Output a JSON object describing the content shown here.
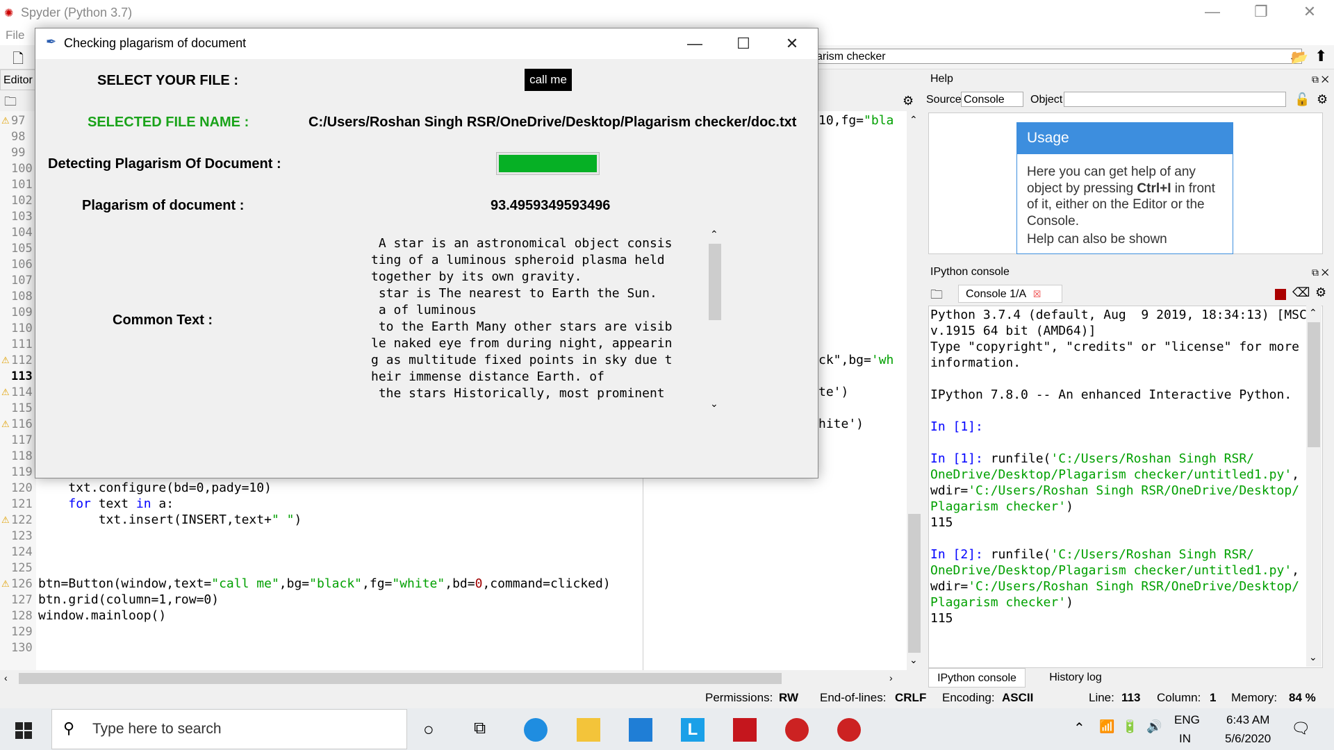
{
  "spyder": {
    "window_title": "Spyder (Python 3.7)",
    "menu_file": "File",
    "working_dir_fragment": "arism checker",
    "editor_label": "Editor",
    "editor_lines": [
      {
        "n": "97",
        "warn": true
      },
      {
        "n": "98"
      },
      {
        "n": "99"
      },
      {
        "n": "100"
      },
      {
        "n": "101"
      },
      {
        "n": "102"
      },
      {
        "n": "103"
      },
      {
        "n": "104"
      },
      {
        "n": "105"
      },
      {
        "n": "106"
      },
      {
        "n": "107"
      },
      {
        "n": "108"
      },
      {
        "n": "109"
      },
      {
        "n": "110"
      },
      {
        "n": "111"
      },
      {
        "n": "112",
        "warn": true
      },
      {
        "n": "113",
        "current": true
      },
      {
        "n": "114",
        "warn": true
      },
      {
        "n": "115"
      },
      {
        "n": "116",
        "warn": true
      },
      {
        "n": "117"
      },
      {
        "n": "118"
      },
      {
        "n": "119"
      },
      {
        "n": "120"
      },
      {
        "n": "121"
      },
      {
        "n": "122",
        "warn": true
      },
      {
        "n": "123"
      },
      {
        "n": "124"
      },
      {
        "n": "125"
      },
      {
        "n": "126",
        "warn": true
      },
      {
        "n": "127"
      },
      {
        "n": "128"
      },
      {
        "n": "129"
      },
      {
        "n": "130"
      }
    ],
    "code": {
      "line120": "    txt.configure(bd=0,pady=10)",
      "line121_kw1": "for",
      "line121_mid": " text ",
      "line121_kw2": "in",
      "line121_end": " a:",
      "line122_a": "        txt.insert(INSERT,text+",
      "line122_str": "\" \"",
      "line122_b": ")",
      "line126_a": "btn=Button(window,text=",
      "line126_s1": "\"call me\"",
      "line126_b": ",bg=",
      "line126_s2": "\"black\"",
      "line126_c": ",fg=",
      "line126_s3": "\"white\"",
      "line126_d": ",bd=",
      "line126_n": "0",
      "line126_e": ",command=clicked)",
      "line127": "btn.grid(column=1,row=0)",
      "line128": "window.mainloop()"
    },
    "editor2": {
      "l97_a": "10,fg=",
      "l97_s": "\"bla",
      "l112_a": "ck\",bg=",
      "l112_s": "'wh",
      "l114": "te')",
      "l116": "hite')"
    },
    "help": {
      "title": "Help",
      "source_label": "Source",
      "source_value": "Console",
      "object_label": "Object",
      "usage_title": "Usage",
      "usage_text_1": "Here you can get help of any object by pressing ",
      "usage_bold": "Ctrl+I",
      "usage_text_2": " in front of it, either on the Editor or the Console.",
      "usage_text_3": "Help can also be shown"
    },
    "ipython": {
      "title": "IPython console",
      "tab_label": "Console 1/A",
      "lines": {
        "l1": "Python 3.7.4 (default, Aug  9 2019, 18:34:13) [MSC",
        "l2": "v.1915 64 bit (AMD64)]",
        "l3": "Type \"copyright\", \"credits\" or \"license\" for more",
        "l4": "information.",
        "l5": "IPython 7.8.0 -- An enhanced Interactive Python.",
        "p1": "In [1]:",
        "p2": "In [1]:",
        "r1a": " runfile(",
        "r1b": "'C:/Users/Roshan Singh RSR/",
        "r1c": "OneDrive/Desktop/Plagarism checker/untitled1.py'",
        "r1d": ",",
        "r1e": "wdir=",
        "r1f": "'C:/Users/Roshan Singh RSR/OneDrive/Desktop/",
        "r1g": "Plagarism checker'",
        "r1h": ")",
        "out1": "115",
        "p3": "In [2]:",
        "out2": "115"
      },
      "bottom_tab_1": "IPython console",
      "bottom_tab_2": "History log"
    },
    "status": {
      "permissions_label": "Permissions:",
      "permissions_value": "RW",
      "eol_label": "End-of-lines:",
      "eol_value": "CRLF",
      "encoding_label": "Encoding:",
      "encoding_value": "ASCII",
      "line_label": "Line:",
      "line_value": "113",
      "column_label": "Column:",
      "column_value": "1",
      "memory_label": "Memory:",
      "memory_value": "84 %"
    }
  },
  "dialog": {
    "title": "Checking plagarism of document",
    "select_label": "SELECT YOUR FILE :",
    "button_label": "call me",
    "selected_label": "SELECTED FILE NAME :",
    "selected_path": "C:/Users/Roshan Singh RSR/OneDrive/Desktop/Plagarism checker/doc.txt",
    "detecting_label": "Detecting Plagarism Of Document :",
    "progress_fraction": 1.0,
    "plagarism_label": "Plagarism of document :",
    "plagarism_value": "93.4959349593496",
    "common_label": "Common Text :",
    "common_text": " A star is an astronomical object consis\nting of a luminous spheroid plasma held\ntogether by its own gravity.\n star is The nearest to Earth the Sun.\n a of luminous\n to the Earth Many other stars are visib\nle naked eye from during night, appearin\ng as multitude fixed points in sky due t\nheir immense distance Earth. of\n the stars Historically, most prominent",
    "colors": {
      "selected_label": "#1aa31a",
      "progress": "#06b025",
      "button_bg": "#000000"
    }
  },
  "taskbar": {
    "search_placeholder": "Type here to search",
    "lang_1": "ENG",
    "lang_2": "IN",
    "time": "6:43 AM",
    "date": "5/6/2020"
  }
}
